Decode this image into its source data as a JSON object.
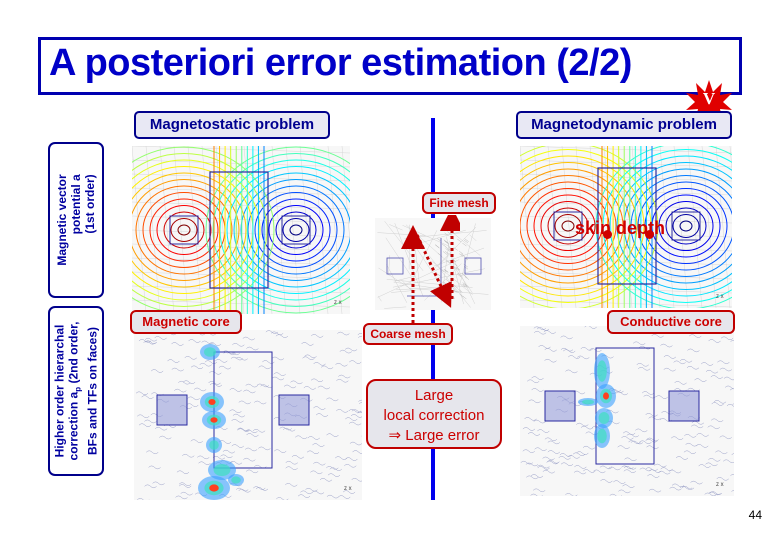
{
  "slide": {
    "title": "A posteriori error estimation (2/2)",
    "badge_letter": "V",
    "page_number": "44"
  },
  "columns": {
    "left_header": "Magnetostatic problem",
    "right_header": "Magnetodynamic problem"
  },
  "row_labels": {
    "top": [
      "Magnetic vector",
      "potential a",
      "(1st order)"
    ],
    "bottom_line1": "Higher order hierarchal",
    "bottom_line2_prefix": "correction a",
    "bottom_line2_sub": "p",
    "bottom_line2_suffix": " (2nd order,",
    "bottom_line3": "BFs and TFs on faces)"
  },
  "annotations": {
    "fine_mesh": "Fine mesh",
    "coarse_mesh": "Coarse mesh",
    "skin_depth": "skin depth",
    "magnetic_core": "Magnetic core",
    "conductive_core": "Conductive core",
    "large_correction": [
      "Large",
      "local correction",
      "⇒ Large error"
    ]
  },
  "axis_glyphs": {
    "x": "x",
    "y": "y",
    "z": "z"
  },
  "colors": {
    "title_blue": "#0000c8",
    "frame_blue": "#0000b0",
    "accent_red": "#cc0000",
    "divider_blue": "#0000ee"
  }
}
